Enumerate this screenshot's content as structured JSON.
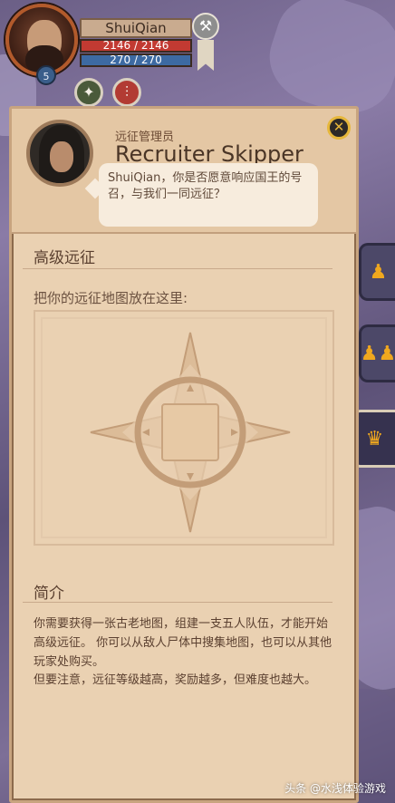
{
  "player": {
    "name": "ShuiQian",
    "hp": "2146 / 2146",
    "mp": "270 / 270",
    "level": "5"
  },
  "npc": {
    "role": "远征管理员",
    "name": "Recruiter Skipper",
    "greeting": "ShuiQian，你是否愿意响应国王的号召，与我们一同远征？"
  },
  "expedition": {
    "title": "高级远征",
    "instruction": "把你的远征地图放在这里:",
    "intro_title": "简介",
    "intro_p1": "你需要获得一张古老地图，组建一支五人队伍，才能开始高级远征。 你可以从敌人尸体中搜集地图，也可以从其他玩家处购买。",
    "intro_p2": "但要注意，远征等级越高，奖励越多，但难度也越大。"
  },
  "icons": {
    "close": "close-icon",
    "hammer": "hammer-icon",
    "tab_solo": "solo-figure-icon",
    "tab_group": "group-figures-icon",
    "tab_crown": "crown-icon"
  },
  "colors": {
    "panel": "#ead1b2",
    "accent_gold": "#e6b73b",
    "hp": "#c23a32",
    "mp": "#3d6aa2"
  },
  "watermark": "头条 @水浅体验游戏"
}
